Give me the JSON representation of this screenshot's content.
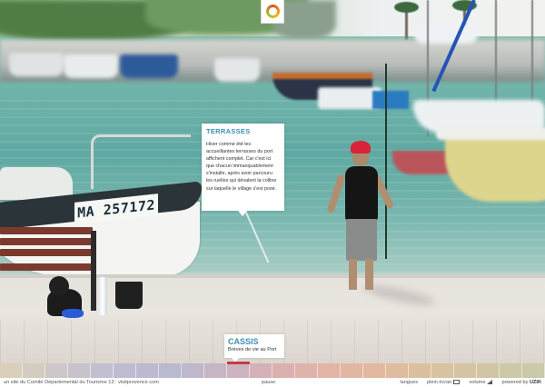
{
  "info_card": {
    "title": "TERRASSES",
    "body": "Hiver comme été les accueillantes terrasses du port affichent complet. Car c'est ici que chacun immanquablement s'installe, après avoir parcouru les ruelles qui dévalent la colline sur laquelle le village s'est posé."
  },
  "place_card": {
    "name": "CASSIS",
    "subtitle": "Brèves de vie au Port"
  },
  "scene": {
    "boat_registration": "MA 257172"
  },
  "timeline": {
    "colors": [
      "#d9cfba",
      "#d4ccc0",
      "#cdc7c8",
      "#c7c2cc",
      "#c2bfd0",
      "#bebcd1",
      "#bbbad1",
      "#b9b9cf",
      "#bfb7cb",
      "#c6b5c5",
      "#cdb3be",
      "#d4b1b6",
      "#dab1af",
      "#dfb2aa",
      "#e2b4a6",
      "#e3b6a2",
      "#e2b9a0",
      "#e0bc9e",
      "#dcbf9e",
      "#d8c2a0",
      "#d4c4a2",
      "#d1c6a4",
      "#cdc8a7",
      "#cac9aa"
    ],
    "active_index": 10,
    "marker_color": "#c23b4a"
  },
  "footer": {
    "credit": "un site du Comité Départemental du Tourisme 13  :  visitprovence.com",
    "pause": "pause",
    "langues": "langues",
    "fullscreen": "plein écran",
    "volume": "volume",
    "powered_prefix": "powered by",
    "powered_brand": "UZIK"
  },
  "icons": {
    "logo": "provence-logo-icon",
    "fullscreen": "fullscreen-icon",
    "volume": "volume-icon"
  }
}
